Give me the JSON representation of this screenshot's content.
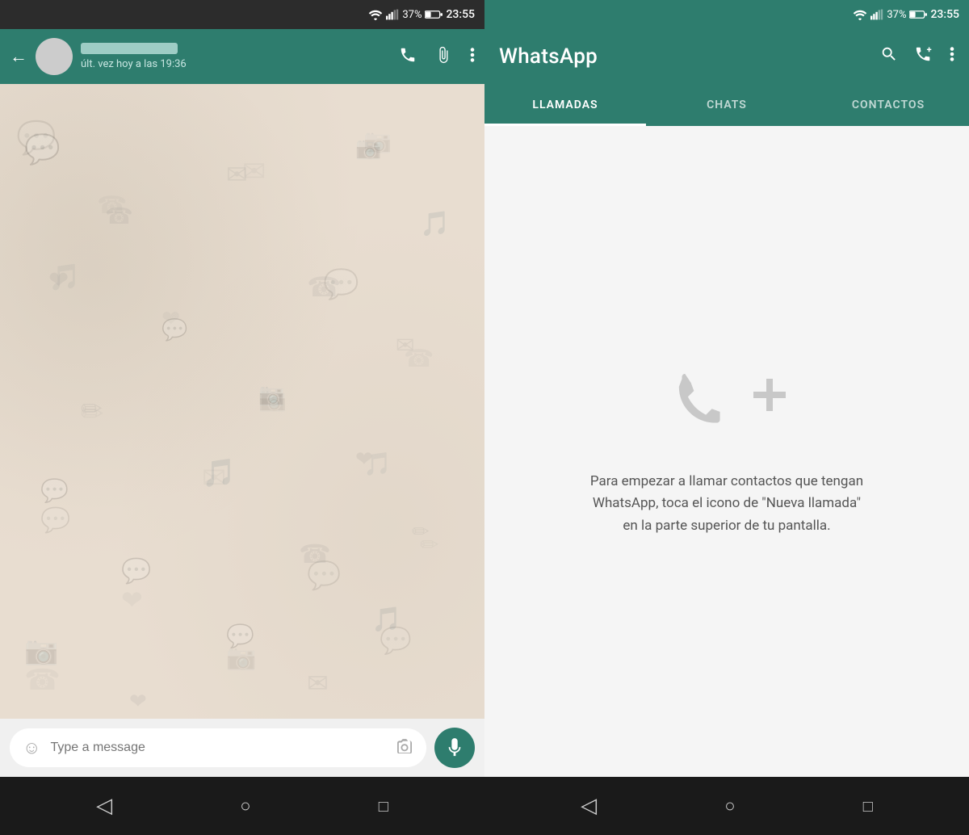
{
  "left_panel": {
    "status_bar": {
      "wifi_icon": "wifi",
      "signal_icon": "signal",
      "battery": "37%",
      "time": "23:55"
    },
    "chat_header": {
      "contact_status": "últ. vez hoy a las 19:36",
      "phone_icon": "phone",
      "attach_icon": "attach",
      "menu_icon": "menu"
    },
    "message_input": {
      "placeholder": "Type a message",
      "emoji_icon": "emoji",
      "camera_icon": "camera",
      "mic_icon": "mic"
    }
  },
  "right_panel": {
    "status_bar": {
      "wifi_icon": "wifi",
      "signal_icon": "signal",
      "battery": "37%",
      "time": "23:55"
    },
    "header": {
      "title": "WhatsApp",
      "search_icon": "search",
      "new_call_icon": "new-call",
      "menu_icon": "menu"
    },
    "tabs": [
      {
        "label": "LLAMADAS",
        "active": true
      },
      {
        "label": "CHATS",
        "active": false
      },
      {
        "label": "CONTACTOS",
        "active": false
      }
    ],
    "empty_state": {
      "message": "Para empezar a llamar contactos que tengan WhatsApp, toca el icono de \"Nueva llamada\" en la parte superior de tu pantalla."
    }
  },
  "bottom_nav": {
    "back_icon": "◁",
    "home_icon": "○",
    "recents_icon": "□"
  }
}
